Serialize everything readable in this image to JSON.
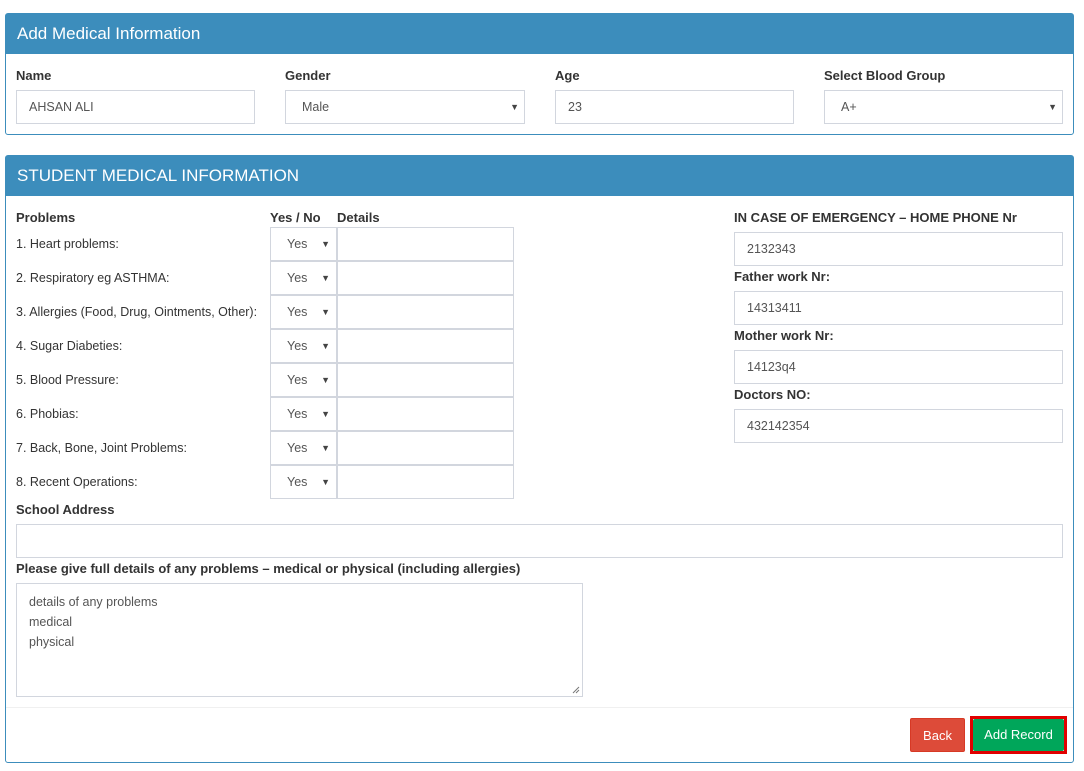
{
  "panel1": {
    "title": "Add Medical Information",
    "fields": {
      "name_label": "Name",
      "name_value": "AHSAN ALI",
      "gender_label": "Gender",
      "gender_value": "Male",
      "age_label": "Age",
      "age_value": "23",
      "blood_label": "Select Blood Group",
      "blood_value": "A+"
    }
  },
  "panel2": {
    "title": "STUDENT MEDICAL INFORMATION",
    "col_problems": "Problems",
    "col_yesno": "Yes / No",
    "col_details": "Details",
    "problems": [
      {
        "label": "1. Heart problems:",
        "answer": "Yes"
      },
      {
        "label": "2. Respiratory eg ASTHMA:",
        "answer": "Yes"
      },
      {
        "label": "3. Allergies (Food, Drug, Ointments, Other):",
        "answer": "Yes"
      },
      {
        "label": "4. Sugar Diabeties:",
        "answer": "Yes"
      },
      {
        "label": "5. Blood Pressure:",
        "answer": "Yes"
      },
      {
        "label": "6. Phobias:",
        "answer": "Yes"
      },
      {
        "label": "7. Back, Bone, Joint Problems:",
        "answer": "Yes"
      },
      {
        "label": "8. Recent Operations:",
        "answer": "Yes"
      }
    ],
    "emergency": {
      "home_label": "IN CASE OF EMERGENCY – HOME PHONE Nr",
      "home_value": "2132343",
      "father_label": "Father work Nr:",
      "father_value": "14313411",
      "mother_label": "Mother work Nr:",
      "mother_value": "14123q4",
      "doctor_label": "Doctors NO:",
      "doctor_value": "432142354"
    },
    "school_address_label": "School Address",
    "school_address_value": "",
    "details_label": "Please give full details of any problems – medical or physical (including allergies)",
    "details_lines": [
      "details of any problems",
      "medical",
      "physical"
    ],
    "back_label": "Back",
    "add_label": "Add Record"
  },
  "icons": {
    "caret": "▼"
  }
}
